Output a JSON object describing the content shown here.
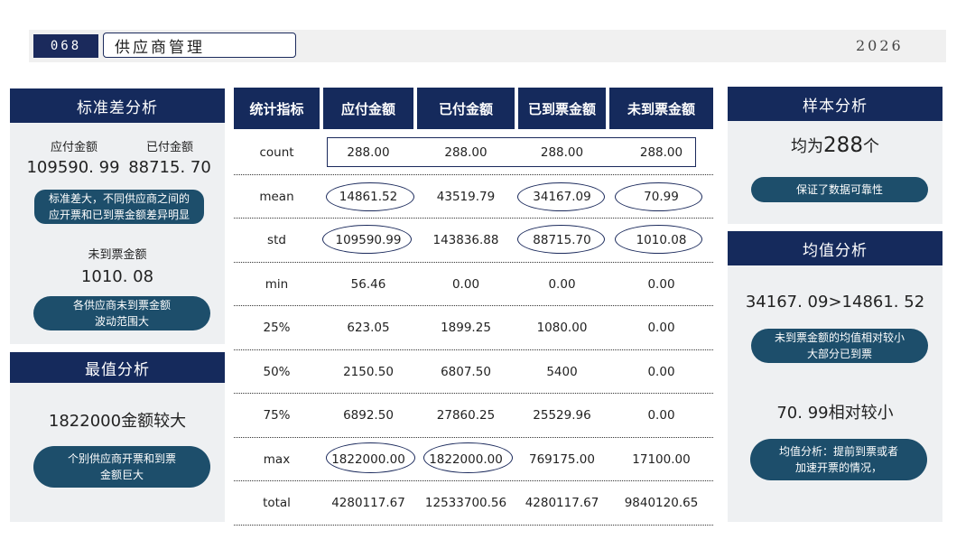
{
  "header": {
    "page_number": "068",
    "title": "供应商管理",
    "year": "2026"
  },
  "std_panel": {
    "title": "标准差分析",
    "label_payable": "应付金额",
    "label_paid": "已付金额",
    "value_payable": "109590. 99",
    "value_paid": "88715. 70",
    "note1": [
      "标准差大，不同供应商之间的",
      "应开票和已到票金额差异明显"
    ],
    "label_unreceived": "未到票金额",
    "value_unreceived": "1010. 08",
    "note2": [
      "各供应商未到票金额",
      "波动范围大"
    ]
  },
  "max_panel": {
    "title": "最值分析",
    "headline": "1822000金额较大",
    "note": [
      "个别供应商开票和到票",
      "金额巨大"
    ]
  },
  "table": {
    "headers": [
      "统计指标",
      "应付金额",
      "已付金额",
      "已到票金额",
      "未到票金额"
    ],
    "rows": [
      [
        "count",
        "288.00",
        "288.00",
        "288.00",
        "288.00"
      ],
      [
        "mean",
        "14861.52",
        "43519.79",
        "34167.09",
        "70.99"
      ],
      [
        "std",
        "109590.99",
        "143836.88",
        "88715.70",
        "1010.08"
      ],
      [
        "min",
        "56.46",
        "0.00",
        "0.00",
        "0.00"
      ],
      [
        "25%",
        "623.05",
        "1899.25",
        "1080.00",
        "0.00"
      ],
      [
        "50%",
        "2150.50",
        "6807.50",
        "5400",
        "0.00"
      ],
      [
        "75%",
        "6892.50",
        "27860.25",
        "25529.96",
        "0.00"
      ],
      [
        "max",
        "1822000.00",
        "1822000.00",
        "769175.00",
        "17100.00"
      ],
      [
        "total",
        "4280117.67",
        "12533700.56",
        "4280117.67",
        "9840120.65"
      ]
    ]
  },
  "sample_panel": {
    "title": "样本分析",
    "headline_prefix": "均为",
    "headline_number": "288",
    "headline_suffix": "个",
    "note": "保证了数据可靠性"
  },
  "mean_panel": {
    "title": "均值分析",
    "compare": "34167. 09>14861. 52",
    "note1": [
      "未到票金额的均值相对较小",
      "大部分已到票"
    ],
    "headline2": "70. 99相对较小",
    "note2": [
      "均值分析：提前到票或者",
      "加速开票的情况，"
    ]
  },
  "colors": {
    "navy": "#152a5c",
    "teal_pill": "#1d4e6b",
    "panel_bg": "#eef0f2"
  }
}
